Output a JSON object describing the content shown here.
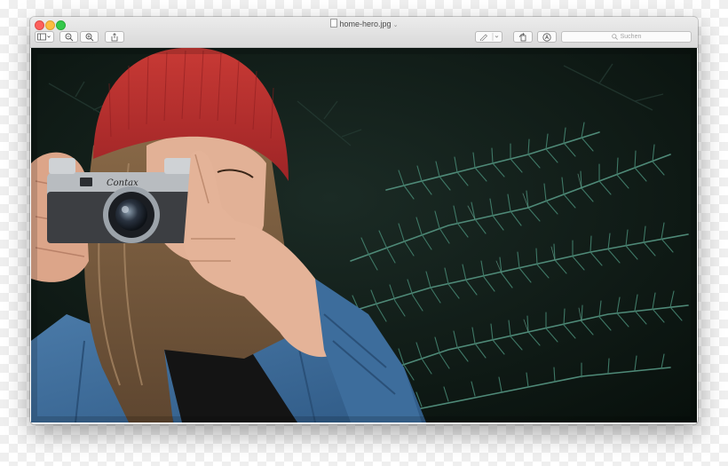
{
  "window": {
    "title": "home-hero.jpg",
    "title_chevron": "⌄"
  },
  "toolbar": {
    "sidebar_icon": "sidebar-icon",
    "zoom_out_icon": "zoom-out-icon",
    "zoom_in_icon": "zoom-in-icon",
    "share_icon": "share-icon",
    "markup_icon": "pen-icon",
    "rotate_icon": "rotate-icon",
    "annotate_icon": "annotate-icon"
  },
  "search": {
    "placeholder": "Suchen"
  },
  "colors": {
    "close": "#fc605c",
    "minimize": "#fdbc40",
    "maximize": "#34c84a",
    "hat": "#b8262b",
    "foliage": "#2d5a4c"
  }
}
